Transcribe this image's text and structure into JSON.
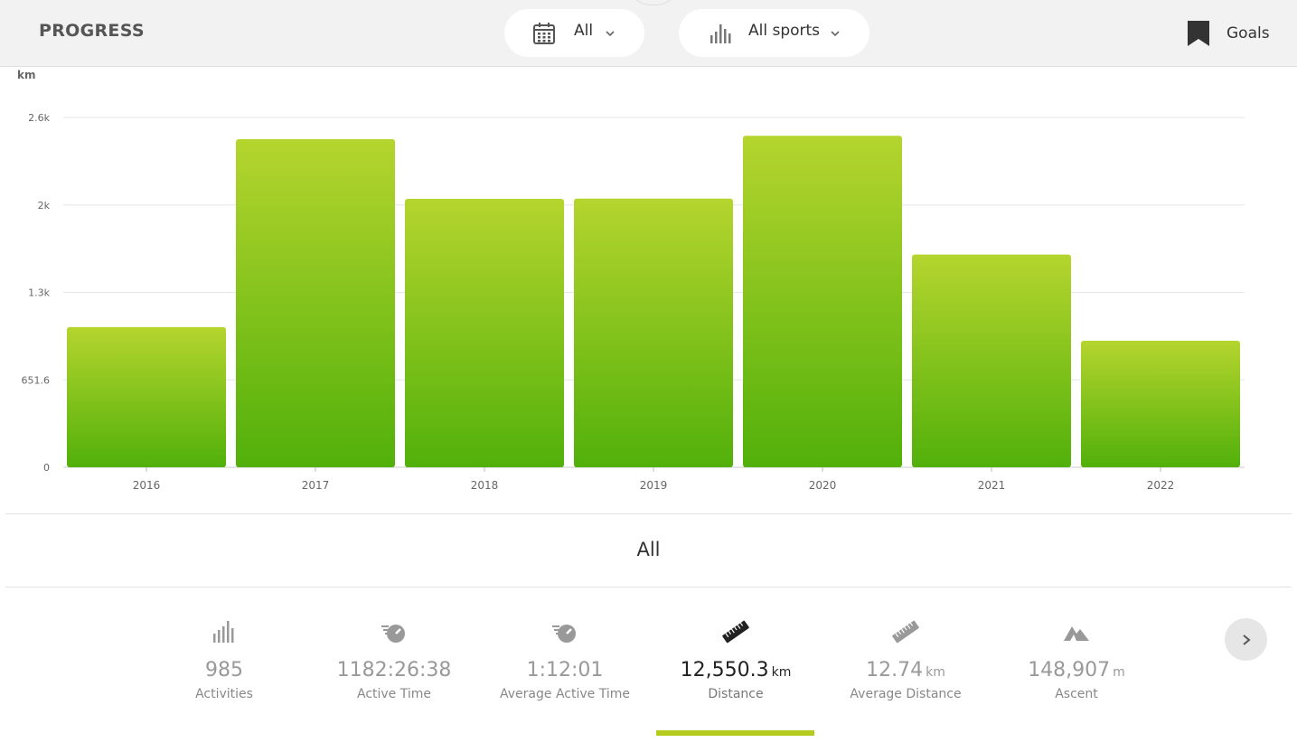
{
  "header": {
    "title": "PROGRESS",
    "date_filter": "All",
    "sport_filter": "All sports",
    "goals_label": "Goals"
  },
  "icons": {
    "date": "calendar-icon",
    "sport": "bar-chart-icon",
    "goals": "bookmark-icon",
    "chevron": "chevron-down-icon",
    "next": "chevron-right-icon"
  },
  "colors": {
    "bar_top": "#b5d52e",
    "bar_bottom": "#52b00a",
    "accent": "#b5cc1e",
    "header_bg": "#f2f2f2"
  },
  "chart_data": {
    "type": "bar",
    "ylabel": "km",
    "categories": [
      "2016",
      "2017",
      "2018",
      "2019",
      "2020",
      "2021",
      "2022"
    ],
    "values": [
      1045,
      2445,
      2000,
      2002,
      2470,
      1585,
      943
    ],
    "yticks": [
      0,
      651.6,
      1303.2,
      1954.8,
      2606.4
    ],
    "ytick_labels": [
      "0",
      "651.6",
      "1.3k",
      "2k",
      "2.6k"
    ],
    "ylim": [
      0,
      2606.4
    ],
    "grid": true
  },
  "summary": {
    "period_label": "All",
    "stats": [
      {
        "icon": "bar-chart-icon",
        "value": "985",
        "unit": "",
        "label": "Activities",
        "active": false
      },
      {
        "icon": "stopwatch-icon",
        "value": "1182:26:38",
        "unit": "",
        "label": "Active Time",
        "active": false
      },
      {
        "icon": "stopwatch-icon",
        "value": "1:12:01",
        "unit": "",
        "label": "Average Active Time",
        "active": false
      },
      {
        "icon": "ruler-icon",
        "value": "12,550.3",
        "unit": "km",
        "label": "Distance",
        "active": true
      },
      {
        "icon": "ruler-icon",
        "value": "12.74",
        "unit": "km",
        "label": "Average Distance",
        "active": false
      },
      {
        "icon": "mountain-icon",
        "value": "148,907",
        "unit": "m",
        "label": "Ascent",
        "active": false
      }
    ]
  }
}
